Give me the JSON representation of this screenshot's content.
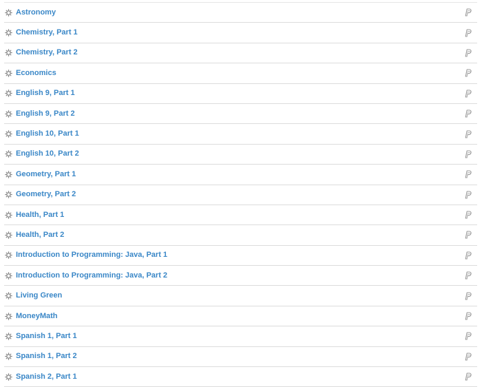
{
  "courses": [
    {
      "name": "Astronomy",
      "course_icon": "course-gear-icon",
      "action_icon": "paypal-icon"
    },
    {
      "name": "Chemistry, Part 1",
      "course_icon": "course-gear-icon",
      "action_icon": "paypal-icon"
    },
    {
      "name": "Chemistry, Part 2",
      "course_icon": "course-gear-icon",
      "action_icon": "paypal-icon"
    },
    {
      "name": "Economics",
      "course_icon": "course-gear-icon",
      "action_icon": "paypal-icon"
    },
    {
      "name": "English 9, Part 1",
      "course_icon": "course-gear-icon",
      "action_icon": "paypal-icon"
    },
    {
      "name": "English 9, Part 2",
      "course_icon": "course-gear-icon",
      "action_icon": "paypal-icon"
    },
    {
      "name": "English 10, Part 1",
      "course_icon": "course-gear-icon",
      "action_icon": "paypal-icon"
    },
    {
      "name": "English 10, Part 2",
      "course_icon": "course-gear-icon",
      "action_icon": "paypal-icon"
    },
    {
      "name": "Geometry, Part 1",
      "course_icon": "course-gear-icon",
      "action_icon": "paypal-icon"
    },
    {
      "name": "Geometry, Part 2",
      "course_icon": "course-gear-icon",
      "action_icon": "paypal-icon"
    },
    {
      "name": "Health, Part 1",
      "course_icon": "course-gear-icon",
      "action_icon": "paypal-icon"
    },
    {
      "name": "Health, Part 2",
      "course_icon": "course-gear-icon",
      "action_icon": "paypal-icon"
    },
    {
      "name": "Introduction to Programming: Java, Part 1",
      "course_icon": "course-gear-icon",
      "action_icon": "paypal-icon"
    },
    {
      "name": "Introduction to Programming: Java, Part 2",
      "course_icon": "course-gear-icon",
      "action_icon": "paypal-icon"
    },
    {
      "name": "Living Green",
      "course_icon": "course-gear-icon",
      "action_icon": "paypal-icon"
    },
    {
      "name": "MoneyMath",
      "course_icon": "course-gear-icon",
      "action_icon": "paypal-icon"
    },
    {
      "name": "Spanish 1, Part 1",
      "course_icon": "course-gear-icon",
      "action_icon": "paypal-icon"
    },
    {
      "name": "Spanish 1, Part 2",
      "course_icon": "course-gear-icon",
      "action_icon": "paypal-icon"
    },
    {
      "name": "Spanish 2, Part 1",
      "course_icon": "course-gear-icon",
      "action_icon": "paypal-icon"
    }
  ],
  "colors": {
    "link": "#3a87c7",
    "divider": "#dcdcdc",
    "icon": "#8c8c8c"
  }
}
